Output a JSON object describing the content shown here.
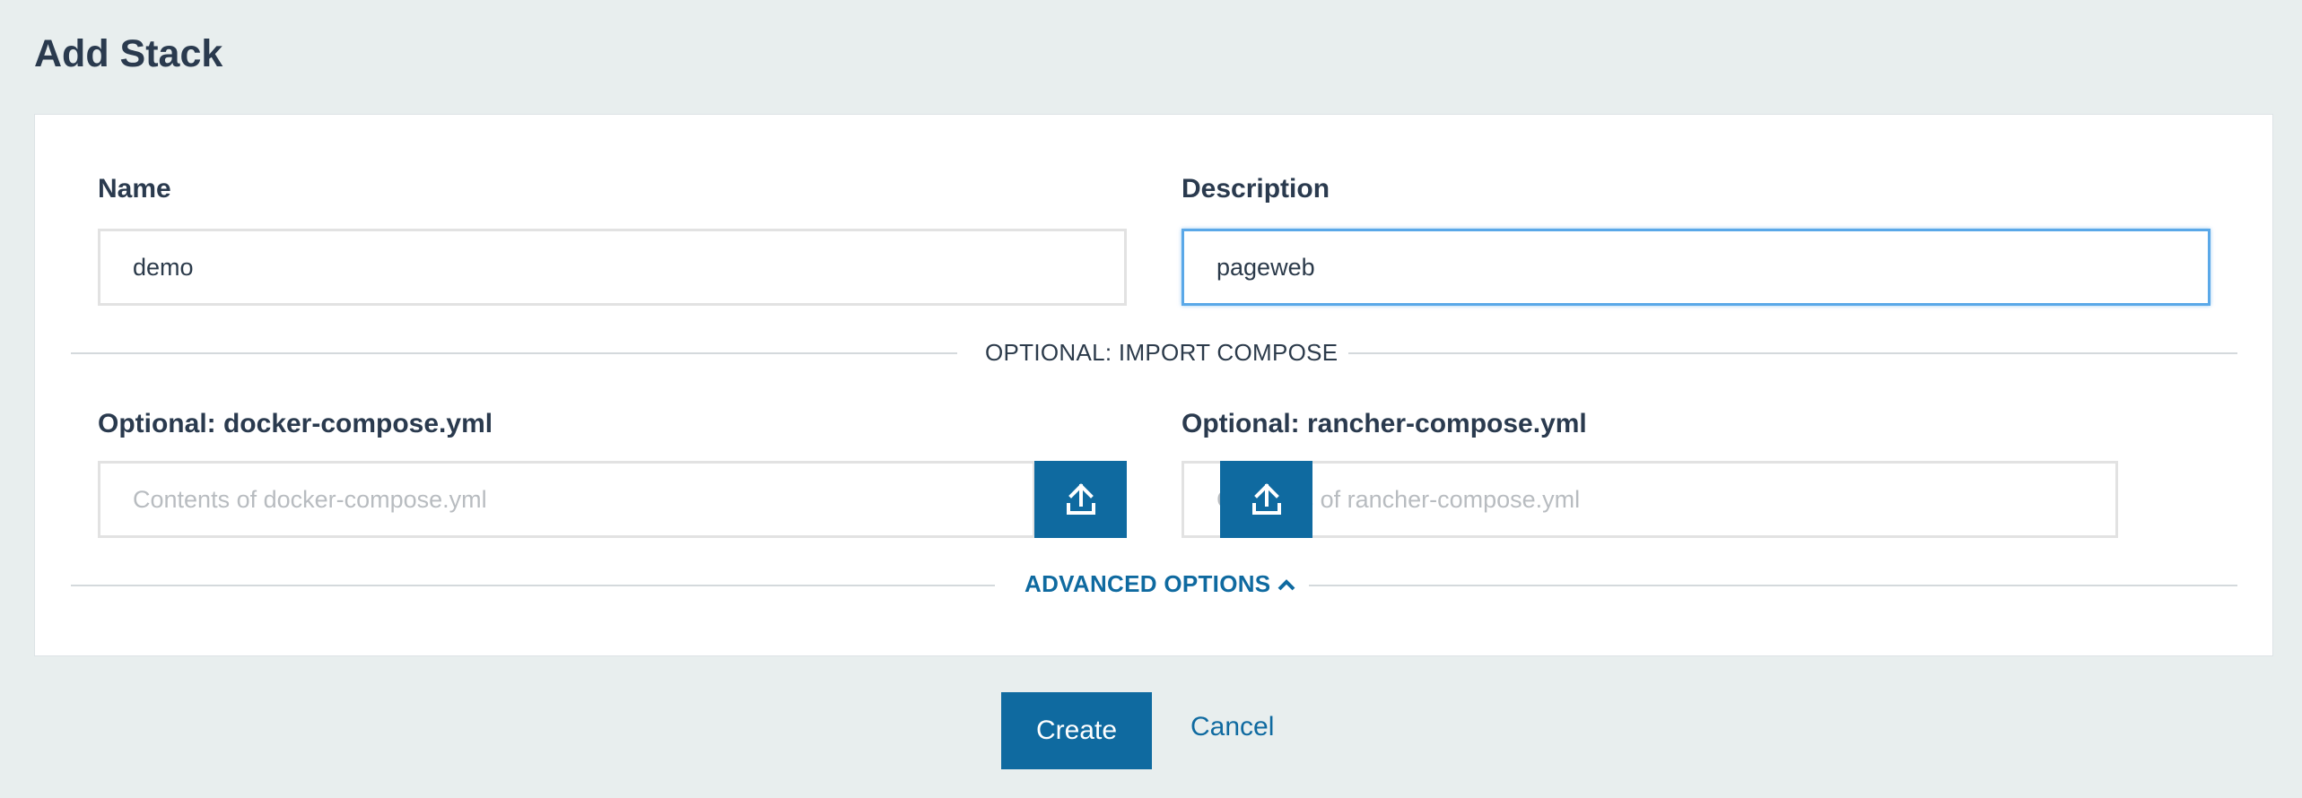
{
  "page": {
    "title": "Add Stack"
  },
  "form": {
    "name": {
      "label": "Name",
      "value": "demo"
    },
    "description": {
      "label": "Description",
      "value": "pageweb"
    },
    "import_divider": "OPTIONAL: IMPORT COMPOSE",
    "docker_compose": {
      "label": "Optional: docker-compose.yml",
      "placeholder": "Contents of docker-compose.yml",
      "upload_icon": "upload-icon"
    },
    "rancher_compose": {
      "label": "Optional: rancher-compose.yml",
      "placeholder": "Contents of rancher-compose.yml",
      "upload_icon": "upload-icon"
    },
    "advanced_options": "ADVANCED OPTIONS",
    "advanced_icon": "chevron-up-icon"
  },
  "actions": {
    "create_label": "Create",
    "cancel_label": "Cancel"
  },
  "colors": {
    "accent": "#0f6aa0",
    "background": "#e8eeee",
    "focus": "#5aa8e8"
  }
}
